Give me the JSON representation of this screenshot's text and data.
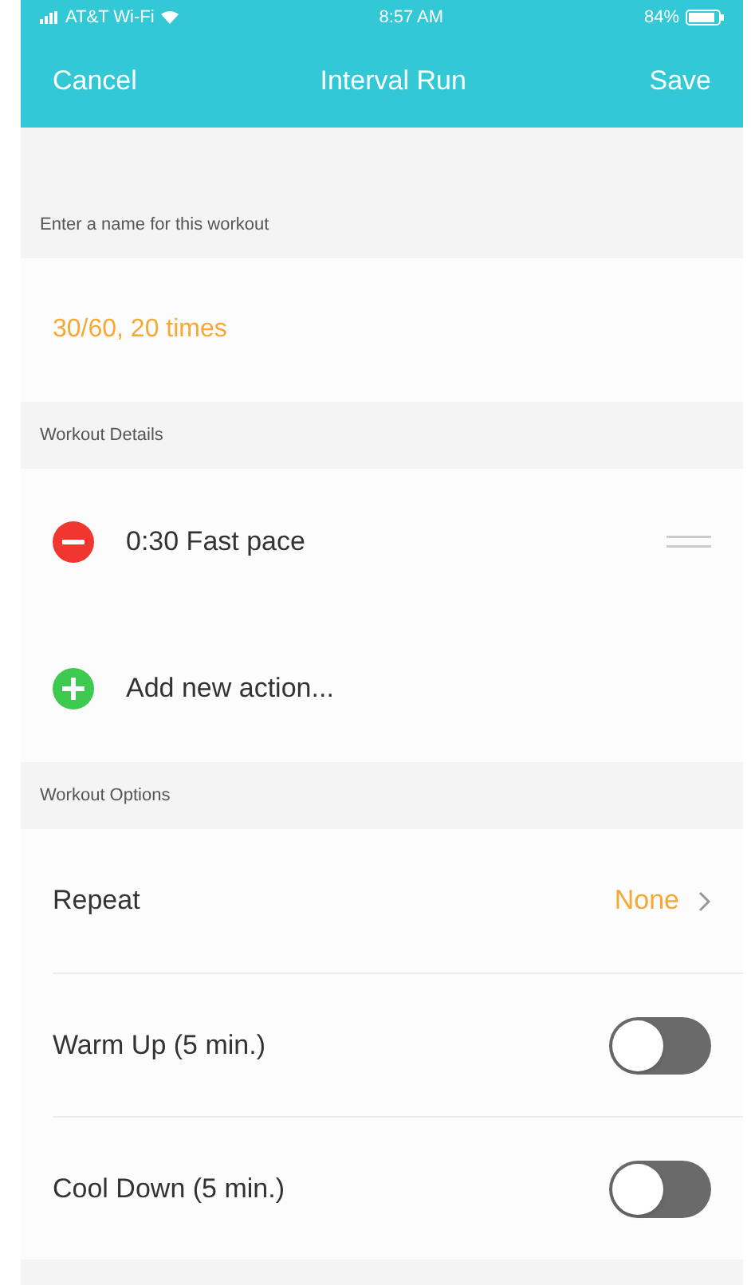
{
  "status_bar": {
    "carrier": "AT&T Wi-Fi",
    "time": "8:57 AM",
    "battery": "84%"
  },
  "nav": {
    "cancel": "Cancel",
    "title": "Interval Run",
    "save": "Save"
  },
  "name_section": {
    "header": "Enter a name for this workout",
    "value": "30/60, 20 times"
  },
  "details": {
    "header": "Workout Details",
    "actions": [
      {
        "kind": "remove",
        "label": "0:30 Fast pace"
      },
      {
        "kind": "add",
        "label": "Add new action..."
      }
    ]
  },
  "options": {
    "header": "Workout Options",
    "items": [
      {
        "kind": "link",
        "label": "Repeat",
        "value": "None"
      },
      {
        "kind": "toggle",
        "label": "Warm Up (5 min.)",
        "on": false
      },
      {
        "kind": "toggle",
        "label": "Cool Down (5 min.)",
        "on": false
      }
    ]
  }
}
